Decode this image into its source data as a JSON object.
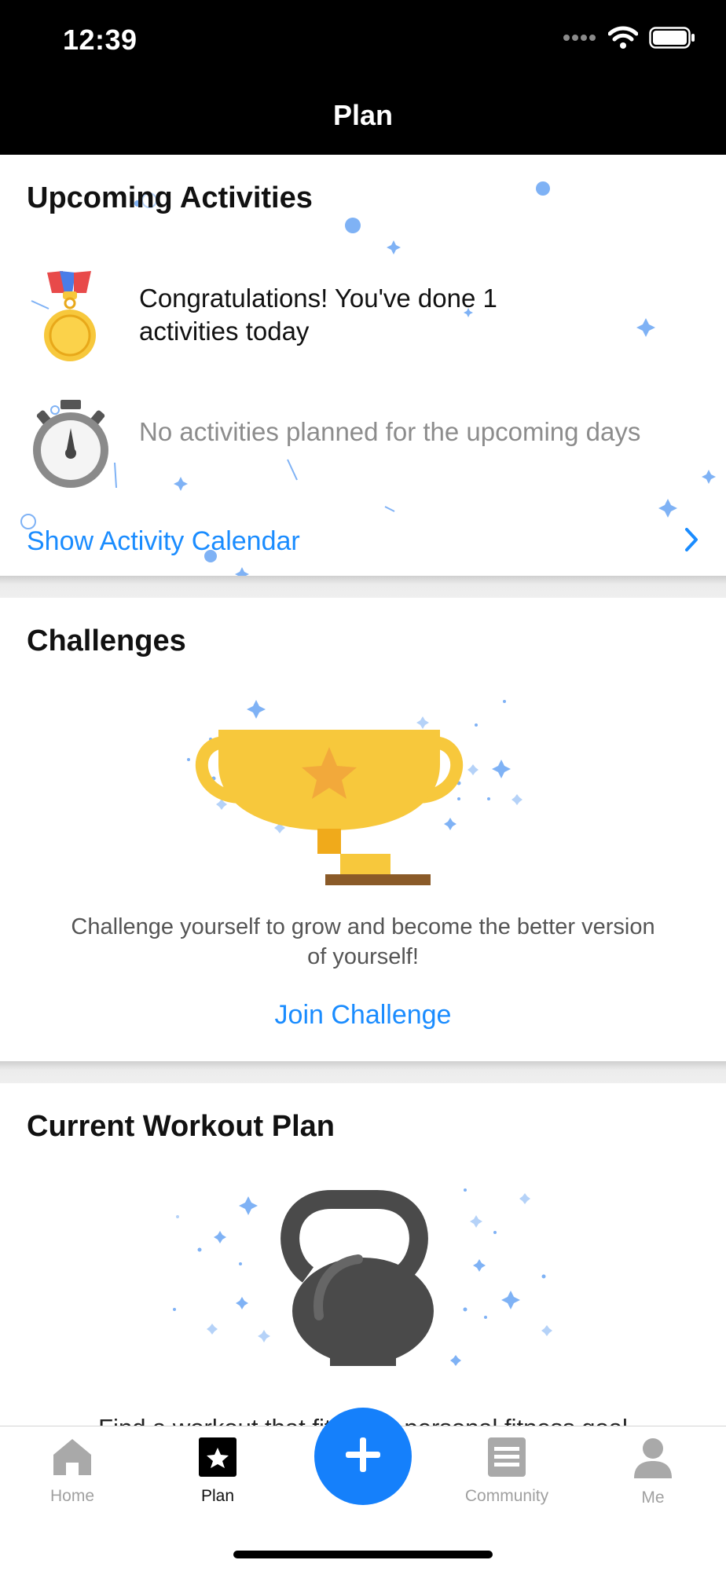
{
  "status_bar": {
    "time": "12:39"
  },
  "nav": {
    "title": "Plan"
  },
  "upcoming": {
    "title": "Upcoming Activities",
    "congrats_line1": "Congratulations! You've done 1",
    "congrats_line2": "activities today",
    "no_activities": "No activities planned for the upcoming days",
    "calendar_link": "Show Activity Calendar"
  },
  "challenges": {
    "title": "Challenges",
    "description_line1": "Challenge yourself to grow and become the better version",
    "description_line2": "of yourself!",
    "join_label": "Join Challenge"
  },
  "workout": {
    "title": "Current Workout Plan",
    "description_partial": "Find a workout that fits your personal fitness goal"
  },
  "tabbar": {
    "items": [
      {
        "label": "Home",
        "icon": "home-icon",
        "active": false
      },
      {
        "label": "Plan",
        "icon": "star-icon",
        "active": true
      },
      {
        "label": "Community",
        "icon": "community-icon",
        "active": false
      },
      {
        "label": "Me",
        "icon": "person-icon",
        "active": false
      }
    ],
    "add_icon": "plus-icon"
  },
  "colors": {
    "accent": "#1a8cff",
    "fab": "#1580fb",
    "trophy": "#f7c83c",
    "kettlebell": "#4a4a4a",
    "sparkle": "#7fb2f5"
  }
}
